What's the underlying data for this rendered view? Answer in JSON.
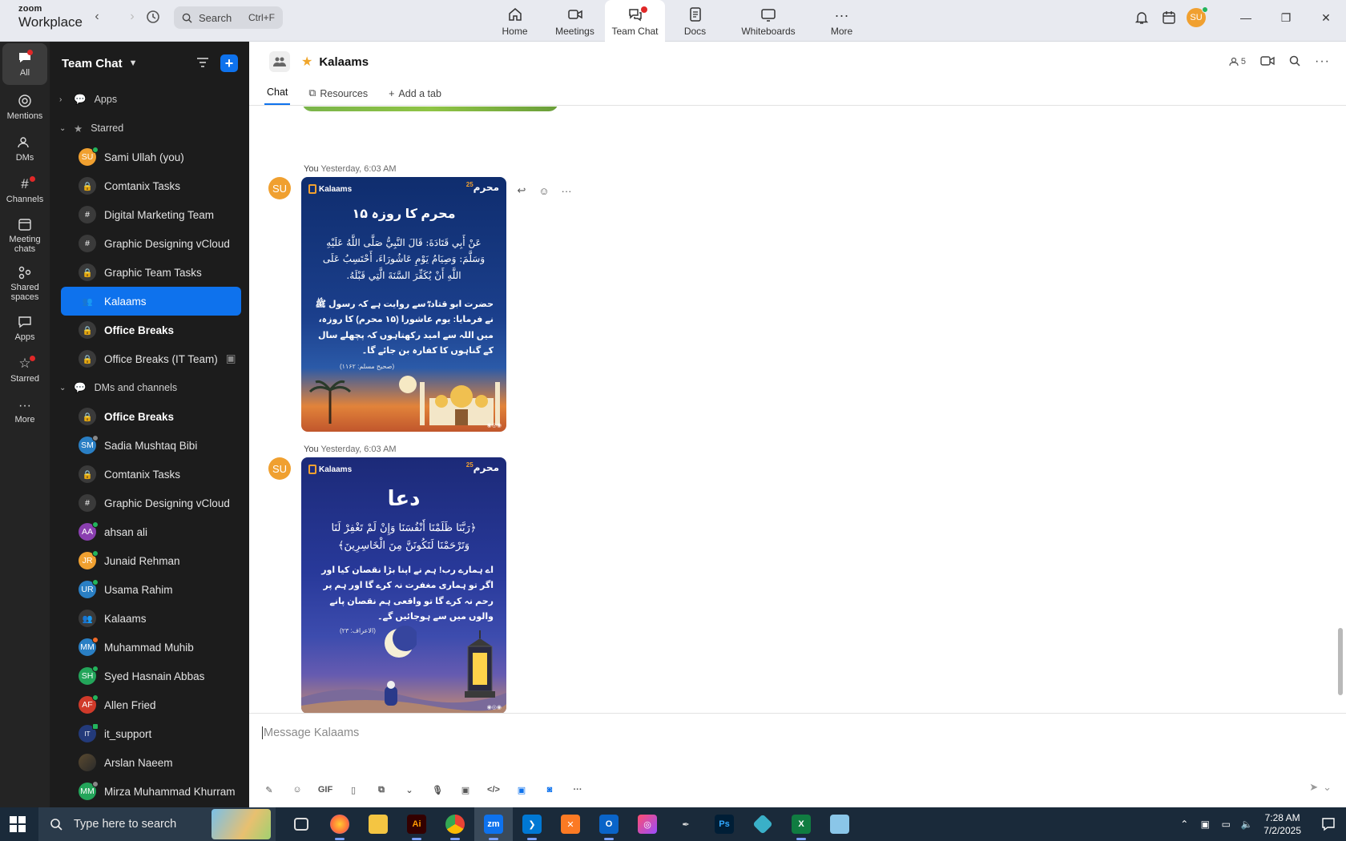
{
  "app": {
    "brand_top": "zoom",
    "brand_bottom": "Workplace"
  },
  "search": {
    "label": "Search",
    "shortcut": "Ctrl+F"
  },
  "top_tabs": [
    {
      "label": "Home"
    },
    {
      "label": "Meetings"
    },
    {
      "label": "Team Chat"
    },
    {
      "label": "Docs"
    },
    {
      "label": "Whiteboards"
    },
    {
      "label": "More"
    }
  ],
  "user_initials": "SU",
  "rail": [
    {
      "label": "All"
    },
    {
      "label": "Mentions"
    },
    {
      "label": "DMs"
    },
    {
      "label": "Channels"
    },
    {
      "label": "Meeting chats"
    },
    {
      "label": "Shared spaces"
    },
    {
      "label": "Apps"
    },
    {
      "label": "Starred"
    },
    {
      "label": "More"
    }
  ],
  "sidebar": {
    "title": "Team Chat",
    "sections": {
      "apps": "Apps",
      "starred": "Starred",
      "dms": "DMs and channels"
    },
    "starred": [
      {
        "label": "Sami Ullah (you)",
        "initials": "SU"
      },
      {
        "label": "Comtanix Tasks"
      },
      {
        "label": "Digital Marketing Team"
      },
      {
        "label": "Graphic Designing vCloud"
      },
      {
        "label": "Graphic Team Tasks"
      },
      {
        "label": "Kalaams"
      },
      {
        "label": "Office Breaks"
      },
      {
        "label": "Office Breaks (IT Team)"
      }
    ],
    "dms": [
      {
        "label": "Office Breaks"
      },
      {
        "label": "Sadia Mushtaq Bibi",
        "initials": "SM"
      },
      {
        "label": "Comtanix Tasks"
      },
      {
        "label": "Graphic Designing vCloud"
      },
      {
        "label": "ahsan ali",
        "initials": "AA"
      },
      {
        "label": "Junaid Rehman",
        "initials": "JR"
      },
      {
        "label": "Usama Rahim",
        "initials": "UR"
      },
      {
        "label": "Kalaams"
      },
      {
        "label": "Muhammad Muhib",
        "initials": "MM"
      },
      {
        "label": "Syed Hasnain Abbas",
        "initials": "SH"
      },
      {
        "label": "Allen Fried",
        "initials": "AF"
      },
      {
        "label": "it_support",
        "initials": "IT"
      },
      {
        "label": "Arslan Naeem"
      },
      {
        "label": "Mirza Muhammad Khurram",
        "initials": "MM"
      }
    ]
  },
  "channel": {
    "name": "Kalaams",
    "member_count": "5",
    "tabs": {
      "chat": "Chat",
      "resources": "Resources",
      "add": "Add a tab"
    }
  },
  "messages": [
    {
      "sender_initials": "SU",
      "sender": "You",
      "time": "Yesterday, 6:03 AM",
      "card": {
        "logo": "Kalaams",
        "badge": "محرم",
        "badge_num": "25",
        "heading": "۱۵ محرم کا روزہ",
        "arabic": "عَنْ أَبِي قَتَادَةَ: قَالَ النَّبِيُّ صَلَّى اللَّهُ عَلَيْهِ وَسَلَّمَ: وَصِيَامُ يَوْمِ عَاشُورَاءَ، أَحْتَسِبُ عَلَى اللَّهِ أَنْ يُكَفِّرَ السَّنَةَ الَّتِي قَبْلَهُ.",
        "urdu": "حضرت ابو قتادہؓ سے روایت ہے کہ رسول ﷺ نے فرمایا: یوم عاشورا (۱۵ محرم) کا روزہ، میں اللہ سے امید رکھتاہوں کہ پچھلے سال کے گناہوں کا کفارہ بن جائے گا۔",
        "ref": "(صحیح مسلم: ۱۱۶۲)"
      }
    },
    {
      "sender_initials": "SU",
      "sender": "You",
      "time": "Yesterday, 6:03 AM",
      "card": {
        "logo": "Kalaams",
        "badge": "محرم",
        "badge_num": "25",
        "heading": "دعا",
        "arabic": "﴿رَبَّنَا ظَلَمْنَا أَنْفُسَنَا وَإِنْ لَمْ تَغْفِرْ لَنَا وَتَرْحَمْنَا لَنَكُونَنَّ مِنَ الْخَاسِرِينَ﴾",
        "urdu": "اے ہمارے رب! ہم نے اپنا بڑا نقصان کیا اور اگر تو ہماری مغفرت نہ کرے گا اور ہم پر رحم نہ کرے گا تو واقعی ہم نقصان پانے والوں میں سے ہوجائیں گے۔",
        "ref": "(الاعراف: ۲۳)"
      }
    }
  ],
  "composer": {
    "placeholder": "Message Kalaams",
    "gif": "GIF"
  },
  "taskbar": {
    "search_placeholder": "Type here to search",
    "time": "7:28 AM",
    "date": "7/2/2025"
  },
  "colors": {
    "accent": "#0e72ed",
    "online": "#23b45c",
    "notify": "#e02828",
    "star": "#f0a62b"
  }
}
